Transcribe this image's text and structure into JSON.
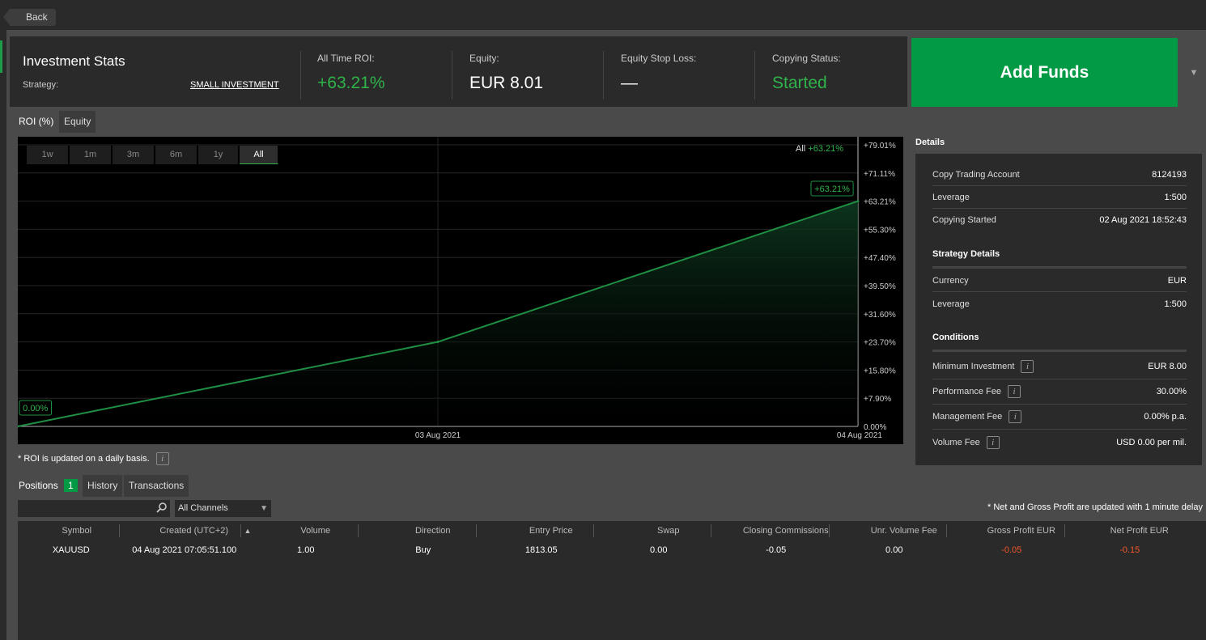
{
  "back_label": "Back",
  "header": {
    "title": "Investment Stats",
    "strategy_label": "Strategy:",
    "strategy_value": "SMALL INVESTMENT",
    "roi_label": "All Time ROI:",
    "roi_value": "+63.21%",
    "equity_label": "Equity:",
    "equity_value": "EUR 8.01",
    "stoploss_label": "Equity Stop Loss:",
    "stoploss_value": "—",
    "status_label": "Copying Status:",
    "status_value": "Started",
    "add_funds": "Add Funds",
    "dropdown_icon": "▼"
  },
  "chart_tabs": [
    "ROI (%)",
    "Equity"
  ],
  "ranges": [
    "1w",
    "1m",
    "3m",
    "6m",
    "1y",
    "All"
  ],
  "active_range": "All",
  "chart_summary": {
    "label": "All",
    "value": "+63.21%"
  },
  "chart_data": {
    "type": "area",
    "x": [
      "02 Aug 2021",
      "03 Aug 2021",
      "04 Aug 2021"
    ],
    "y": [
      0.0,
      23.72,
      63.21
    ],
    "xticks": [
      "03 Aug 2021",
      "04 Aug 2021"
    ],
    "yticks": [
      "0.00%",
      "+7.90%",
      "+15.80%",
      "+23.70%",
      "+31.60%",
      "+39.50%",
      "+47.40%",
      "+55.30%",
      "+63.21%",
      "+71.11%",
      "+79.01%"
    ],
    "ylim": [
      0,
      79.01
    ],
    "start_label": "0.00%",
    "end_label": "+63.21%",
    "color": "#1f8f44",
    "grid": true
  },
  "roi_note": "* ROI is updated on a daily basis.",
  "details": {
    "title": "Details",
    "rows": [
      {
        "label": "Copy Trading Account",
        "value": "8124193"
      },
      {
        "label": "Leverage",
        "value": "1:500"
      },
      {
        "label": "Copying Started",
        "value": "02 Aug 2021 18:52:43"
      }
    ],
    "strategy_title": "Strategy Details",
    "strategy_rows": [
      {
        "label": "Currency",
        "value": "EUR"
      },
      {
        "label": "Leverage",
        "value": "1:500"
      }
    ],
    "conditions_title": "Conditions",
    "conditions_rows": [
      {
        "label": "Minimum Investment",
        "value": "EUR 8.00"
      },
      {
        "label": "Performance Fee",
        "value": "30.00%"
      },
      {
        "label": "Management Fee",
        "value": "0.00% p.a."
      },
      {
        "label": "Volume Fee",
        "value": "USD 0.00 per mil."
      }
    ]
  },
  "bottom_tabs": {
    "positions": "Positions",
    "positions_count": "1",
    "history": "History",
    "transactions": "Transactions"
  },
  "search_placeholder": "",
  "channels_value": "All Channels",
  "profit_note": "* Net and Gross Profit are updated with 1 minute delay",
  "table": {
    "columns": [
      "Symbol",
      "Created (UTC+2)",
      "Volume",
      "Direction",
      "Entry Price",
      "Swap",
      "Closing Commissions",
      "Unr. Volume Fee",
      "Gross Profit EUR",
      "Net Profit EUR"
    ],
    "sort_icon": "▲",
    "rows": [
      [
        "XAUUSD",
        "04 Aug 2021 07:05:51.100",
        "1.00",
        "Buy",
        "1813.05",
        "0.00",
        "-0.05",
        "0.00",
        "-0.05",
        "-0.15"
      ]
    ]
  },
  "colors": {
    "accent": "#2fb34a",
    "button": "#029a45",
    "negative": "#f2562a"
  }
}
